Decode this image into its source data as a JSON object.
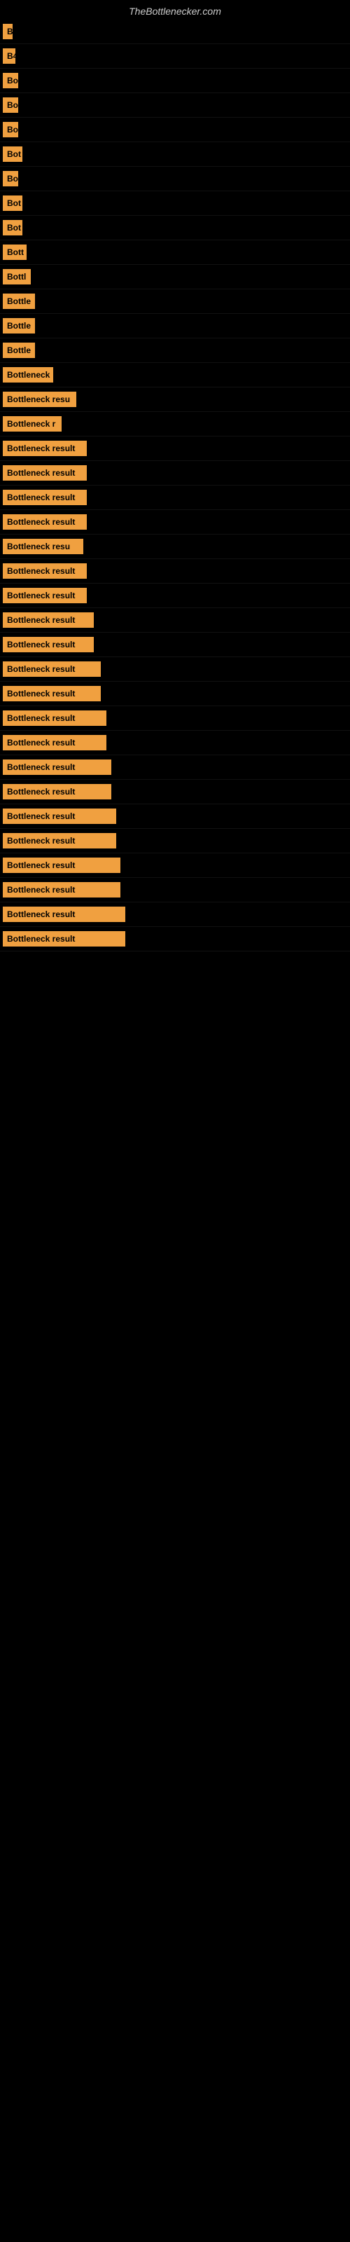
{
  "site": {
    "title": "TheBottlenecker.com"
  },
  "rows": [
    {
      "label": "B",
      "width": 14
    },
    {
      "label": "B4",
      "width": 18
    },
    {
      "label": "Bo",
      "width": 22
    },
    {
      "label": "Bo",
      "width": 22
    },
    {
      "label": "Bo",
      "width": 22
    },
    {
      "label": "Bot",
      "width": 28
    },
    {
      "label": "Bo",
      "width": 22
    },
    {
      "label": "Bot",
      "width": 28
    },
    {
      "label": "Bot",
      "width": 28
    },
    {
      "label": "Bott",
      "width": 34
    },
    {
      "label": "Bottl",
      "width": 40
    },
    {
      "label": "Bottle",
      "width": 46
    },
    {
      "label": "Bottle",
      "width": 46
    },
    {
      "label": "Bottle",
      "width": 46
    },
    {
      "label": "Bottleneck",
      "width": 72
    },
    {
      "label": "Bottleneck resu",
      "width": 105
    },
    {
      "label": "Bottleneck r",
      "width": 84
    },
    {
      "label": "Bottleneck result",
      "width": 120
    },
    {
      "label": "Bottleneck result",
      "width": 120
    },
    {
      "label": "Bottleneck result",
      "width": 120
    },
    {
      "label": "Bottleneck result",
      "width": 120
    },
    {
      "label": "Bottleneck resu",
      "width": 115
    },
    {
      "label": "Bottleneck result",
      "width": 120
    },
    {
      "label": "Bottleneck result",
      "width": 120
    },
    {
      "label": "Bottleneck result",
      "width": 130
    },
    {
      "label": "Bottleneck result",
      "width": 130
    },
    {
      "label": "Bottleneck result",
      "width": 140
    },
    {
      "label": "Bottleneck result",
      "width": 140
    },
    {
      "label": "Bottleneck result",
      "width": 148
    },
    {
      "label": "Bottleneck result",
      "width": 148
    },
    {
      "label": "Bottleneck result",
      "width": 155
    },
    {
      "label": "Bottleneck result",
      "width": 155
    },
    {
      "label": "Bottleneck result",
      "width": 162
    },
    {
      "label": "Bottleneck result",
      "width": 162
    },
    {
      "label": "Bottleneck result",
      "width": 168
    },
    {
      "label": "Bottleneck result",
      "width": 168
    },
    {
      "label": "Bottleneck result",
      "width": 175
    },
    {
      "label": "Bottleneck result",
      "width": 175
    }
  ]
}
